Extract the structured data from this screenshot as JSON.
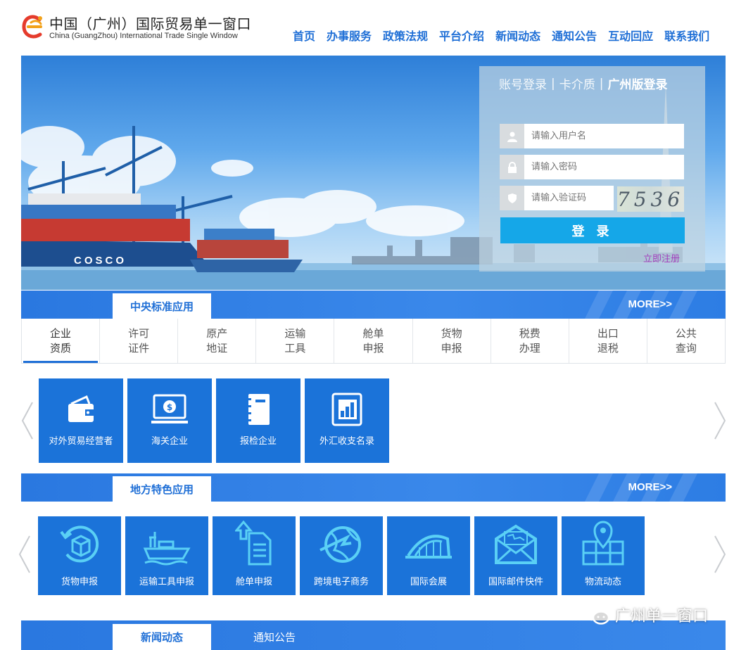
{
  "header": {
    "logo_cn": "中国（广州）国际贸易单一窗口",
    "logo_en": "China (GuangZhou) International Trade Single Window",
    "nav": [
      "首页",
      "办事服务",
      "政策法规",
      "平台介绍",
      "新闻动态",
      "通知公告",
      "互动回应",
      "联系我们"
    ]
  },
  "banner": {
    "ship_name": "COSCO"
  },
  "login": {
    "tabs": [
      "账号登录",
      "卡介质",
      "广州版登录"
    ],
    "active_tab": "广州版登录",
    "username_placeholder": "请输入用户名",
    "password_placeholder": "请输入密码",
    "captcha_placeholder": "请输入验证码",
    "captcha_code": "7536",
    "submit_label": "登 录",
    "register_label": "立即注册"
  },
  "central": {
    "title": "中央标准应用",
    "more": "MORE>>",
    "categories": [
      {
        "l1": "企业",
        "l2": "资质"
      },
      {
        "l1": "许可",
        "l2": "证件"
      },
      {
        "l1": "原产",
        "l2": "地证"
      },
      {
        "l1": "运输",
        "l2": "工具"
      },
      {
        "l1": "舱单",
        "l2": "申报"
      },
      {
        "l1": "货物",
        "l2": "申报"
      },
      {
        "l1": "税费",
        "l2": "办理"
      },
      {
        "l1": "出口",
        "l2": "退税"
      },
      {
        "l1": "公共",
        "l2": "查询"
      }
    ],
    "tiles": [
      {
        "label": "对外贸易经营者",
        "icon": "wallet-icon"
      },
      {
        "label": "海关企业",
        "icon": "customs-monitor-icon"
      },
      {
        "label": "报检企业",
        "icon": "notebook-icon"
      },
      {
        "label": "外汇收支名录",
        "icon": "chart-document-icon"
      }
    ]
  },
  "local": {
    "title": "地方特色应用",
    "more": "MORE>>",
    "tiles": [
      {
        "label": "货物申报",
        "icon": "package-cycle-icon"
      },
      {
        "label": "运输工具申报",
        "icon": "ship-icon"
      },
      {
        "label": "舱单申报",
        "icon": "upload-document-icon"
      },
      {
        "label": "跨境电子商务",
        "icon": "globe-arrow-icon"
      },
      {
        "label": "国际会展",
        "icon": "exhibition-hall-icon"
      },
      {
        "label": "国际邮件快件",
        "icon": "mail-world-icon"
      },
      {
        "label": "物流动态",
        "icon": "map-pin-icon"
      }
    ]
  },
  "news": {
    "tabs": [
      "新闻动态",
      "通知公告"
    ]
  },
  "watermark": "广州单一窗口",
  "colors": {
    "primary": "#1f6fd6",
    "tile": "#1b73d9",
    "login_button": "#15a7e8"
  }
}
